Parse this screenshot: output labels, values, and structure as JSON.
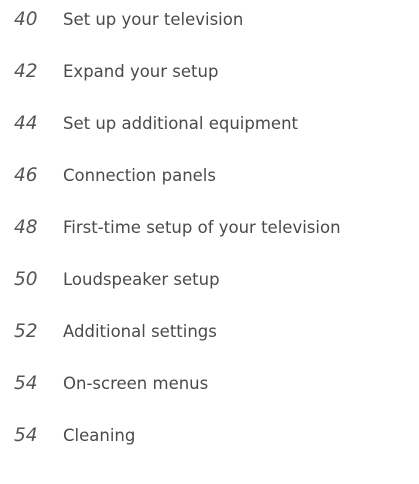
{
  "toc": {
    "entries": [
      {
        "page": "40",
        "title": "Set up your television"
      },
      {
        "page": "42",
        "title": "Expand your setup"
      },
      {
        "page": "44",
        "title": "Set up additional equipment"
      },
      {
        "page": "46",
        "title": "Connection panels"
      },
      {
        "page": "48",
        "title": "First-time setup of your television"
      },
      {
        "page": "50",
        "title": "Loudspeaker setup"
      },
      {
        "page": "52",
        "title": "Additional settings"
      },
      {
        "page": "54",
        "title": "On-screen menus"
      },
      {
        "page": "54",
        "title": "Cleaning"
      }
    ]
  },
  "colors": {
    "text": "#4a4a4a",
    "page_number": "#555555",
    "background": "#ffffff"
  }
}
